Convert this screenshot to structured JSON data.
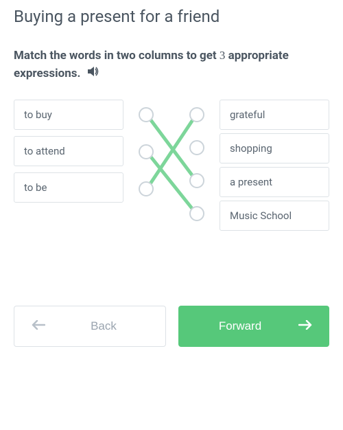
{
  "title": "Buying a present for a friend",
  "instruction": {
    "prefix": "Match the words in two columns to get ",
    "count": "3",
    "suffix": " appropriate expressions."
  },
  "left_words": [
    "to buy",
    "to attend",
    "to be"
  ],
  "right_words": [
    "grateful",
    "shopping",
    "a present",
    "Music School"
  ],
  "connections": [
    {
      "from": 0,
      "to": 2
    },
    {
      "from": 1,
      "to": 3
    },
    {
      "from": 2,
      "to": 0
    }
  ],
  "buttons": {
    "back": "Back",
    "forward": "Forward"
  },
  "colors": {
    "accent": "#56c87a",
    "line": "#7dd69a"
  }
}
